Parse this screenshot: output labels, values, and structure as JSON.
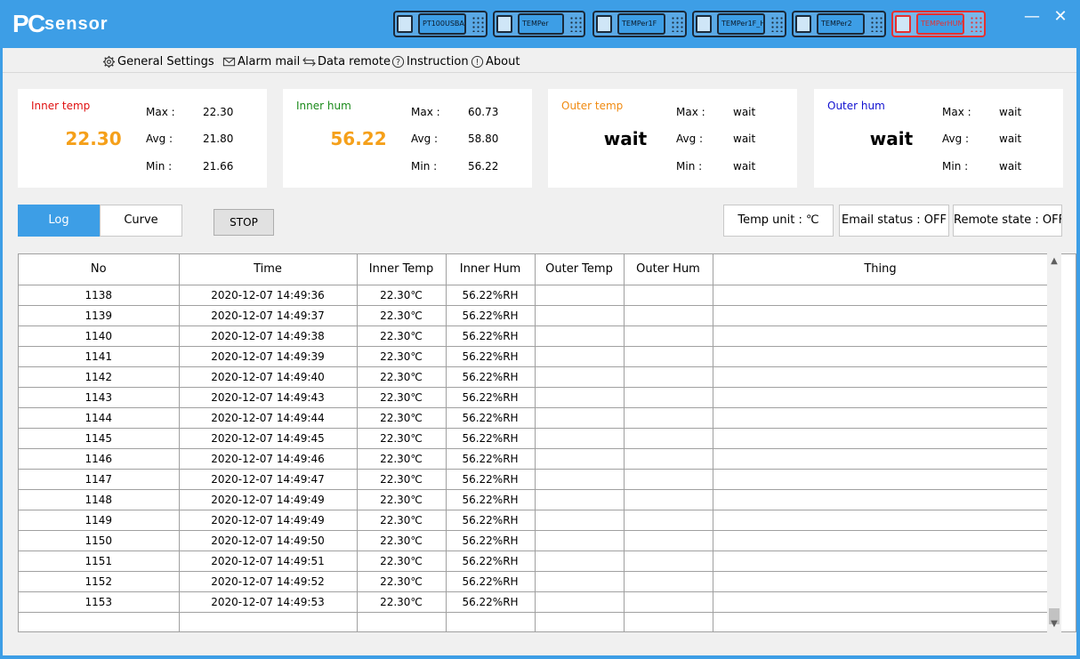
{
  "app": {
    "logo_text": "PCsensor"
  },
  "devices": [
    {
      "label": "PT100USBA",
      "active": false
    },
    {
      "label": "TEMPer",
      "active": false
    },
    {
      "label": "TEMPer1F",
      "active": false
    },
    {
      "label": "TEMPer1F_H1",
      "active": false
    },
    {
      "label": "TEMPer2",
      "active": false
    },
    {
      "label": "TEMPerHUM",
      "active": true
    }
  ],
  "window_controls": {
    "minimize": "—",
    "close": "✕"
  },
  "menu": {
    "general_settings": "General Settings",
    "alarm_mail": "Alarm mail",
    "data_remote": "Data remote",
    "instruction": "Instruction",
    "about": "About"
  },
  "cards": {
    "inner_temp": {
      "title": "Inner temp",
      "value": "22.30",
      "max_label": "Max :",
      "max": "22.30",
      "avg_label": "Avg :",
      "avg": "21.80",
      "min_label": "Min :",
      "min": "21.66",
      "title_color": "#e01010",
      "value_color": "#f5a01a"
    },
    "inner_hum": {
      "title": "Inner hum",
      "value": "56.22",
      "max_label": "Max :",
      "max": "60.73",
      "avg_label": "Avg :",
      "avg": "58.80",
      "min_label": "Min :",
      "min": "56.22",
      "title_color": "#1a8a1a",
      "value_color": "#f5a01a"
    },
    "outer_temp": {
      "title": "Outer temp",
      "value": "wait",
      "max_label": "Max :",
      "max": "wait",
      "avg_label": "Avg :",
      "avg": "wait",
      "min_label": "Min :",
      "min": "wait",
      "title_color": "#f08a10",
      "value_color": "#000000"
    },
    "outer_hum": {
      "title": "Outer hum",
      "value": "wait",
      "max_label": "Max :",
      "max": "wait",
      "avg_label": "Avg :",
      "avg": "wait",
      "min_label": "Min :",
      "min": "wait",
      "title_color": "#1010d0",
      "value_color": "#000000"
    }
  },
  "tabs": {
    "log": "Log",
    "curve": "Curve"
  },
  "stop_label": "STOP",
  "status": {
    "temp_unit": "Temp unit : ℃",
    "email": "Email status : OFF",
    "remote": "Remote state : OFF"
  },
  "table": {
    "columns": [
      "No",
      "Time",
      "Inner Temp",
      "Inner Hum",
      "Outer Temp",
      "Outer Hum",
      "Thing"
    ],
    "rows": [
      [
        "1138",
        "2020-12-07 14:49:36",
        "22.30℃",
        "56.22%RH",
        "",
        "",
        ""
      ],
      [
        "1139",
        "2020-12-07 14:49:37",
        "22.30℃",
        "56.22%RH",
        "",
        "",
        ""
      ],
      [
        "1140",
        "2020-12-07 14:49:38",
        "22.30℃",
        "56.22%RH",
        "",
        "",
        ""
      ],
      [
        "1141",
        "2020-12-07 14:49:39",
        "22.30℃",
        "56.22%RH",
        "",
        "",
        ""
      ],
      [
        "1142",
        "2020-12-07 14:49:40",
        "22.30℃",
        "56.22%RH",
        "",
        "",
        ""
      ],
      [
        "1143",
        "2020-12-07 14:49:43",
        "22.30℃",
        "56.22%RH",
        "",
        "",
        ""
      ],
      [
        "1144",
        "2020-12-07 14:49:44",
        "22.30℃",
        "56.22%RH",
        "",
        "",
        ""
      ],
      [
        "1145",
        "2020-12-07 14:49:45",
        "22.30℃",
        "56.22%RH",
        "",
        "",
        ""
      ],
      [
        "1146",
        "2020-12-07 14:49:46",
        "22.30℃",
        "56.22%RH",
        "",
        "",
        ""
      ],
      [
        "1147",
        "2020-12-07 14:49:47",
        "22.30℃",
        "56.22%RH",
        "",
        "",
        ""
      ],
      [
        "1148",
        "2020-12-07 14:49:49",
        "22.30℃",
        "56.22%RH",
        "",
        "",
        ""
      ],
      [
        "1149",
        "2020-12-07 14:49:49",
        "22.30℃",
        "56.22%RH",
        "",
        "",
        ""
      ],
      [
        "1150",
        "2020-12-07 14:49:50",
        "22.30℃",
        "56.22%RH",
        "",
        "",
        ""
      ],
      [
        "1151",
        "2020-12-07 14:49:51",
        "22.30℃",
        "56.22%RH",
        "",
        "",
        ""
      ],
      [
        "1152",
        "2020-12-07 14:49:52",
        "22.30℃",
        "56.22%RH",
        "",
        "",
        ""
      ],
      [
        "1153",
        "2020-12-07 14:49:53",
        "22.30℃",
        "56.22%RH",
        "",
        "",
        ""
      ],
      [
        "",
        "",
        "",
        "",
        "",
        "",
        ""
      ]
    ]
  },
  "colors": {
    "accent": "#3d9ee6",
    "active_device": "#e63030"
  }
}
